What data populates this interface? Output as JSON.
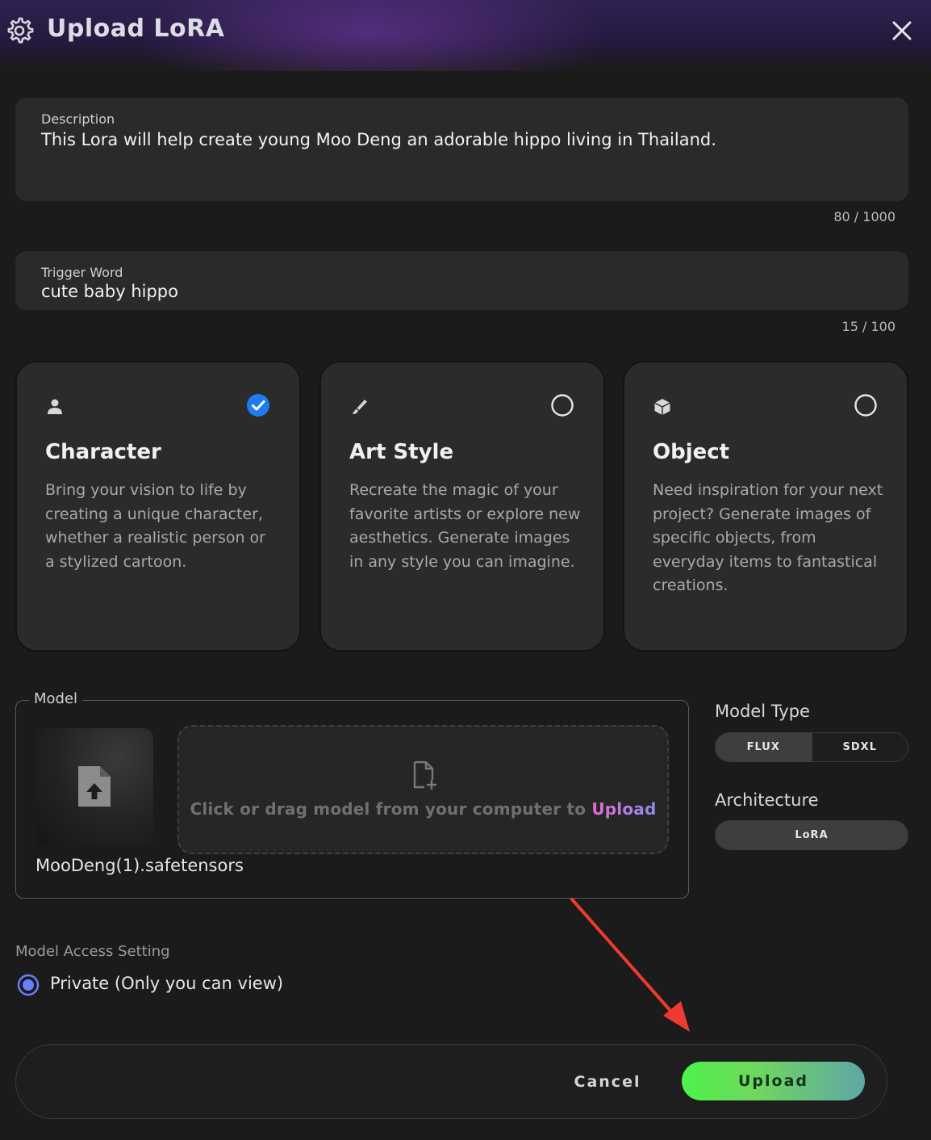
{
  "header": {
    "title": "Upload LoRA"
  },
  "description": {
    "label": "Description",
    "value": "This Lora will help create young Moo Deng an adorable hippo living in Thailand.",
    "counter": "80 / 1000"
  },
  "trigger": {
    "label": "Trigger Word",
    "value": "cute baby hippo",
    "counter": "15 / 100"
  },
  "categories": [
    {
      "icon": "person-icon",
      "title": "Character",
      "desc": "Bring your vision to life by creating a unique character, whether a realistic person or a stylized cartoon.",
      "selected": true
    },
    {
      "icon": "brush-icon",
      "title": "Art Style",
      "desc": "Recreate the magic of your favorite artists or explore new aesthetics. Generate images in any style you can imagine.",
      "selected": false
    },
    {
      "icon": "cube-icon",
      "title": "Object",
      "desc": "Need inspiration for your next project? Generate images of specific objects, from everyday items to fantastical creations.",
      "selected": false
    }
  ],
  "model": {
    "legend": "Model",
    "filename": "MooDeng(1).safetensors",
    "dropzone_text": "Click or drag model from your computer to ",
    "dropzone_link": "Upload"
  },
  "model_type": {
    "label": "Model Type",
    "options": [
      "FLUX",
      "SDXL"
    ],
    "selected": "FLUX"
  },
  "architecture": {
    "label": "Architecture",
    "value": "LoRA"
  },
  "access": {
    "label": "Model Access Setting",
    "option": "Private (Only you can view)",
    "selected": true
  },
  "footer": {
    "cancel_label": "Cancel",
    "upload_label": "Upload"
  },
  "colors": {
    "accent_check": "#1f7cf0",
    "radio_accent": "#6b7dff",
    "upload_gradient_start": "#4ef24a",
    "upload_gradient_end": "#5fa6a6",
    "annotation_arrow": "#ee3a2f"
  }
}
